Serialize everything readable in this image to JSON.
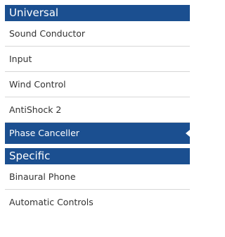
{
  "universal": {
    "title": "Universal",
    "items": [
      {
        "label": "Sound Conductor"
      },
      {
        "label": "Input"
      },
      {
        "label": "Wind Control"
      },
      {
        "label": "AntiShock 2"
      },
      {
        "label": "Phase Canceller"
      }
    ]
  },
  "specific": {
    "title": "Specific",
    "items": [
      {
        "label": "Binaural Phone"
      },
      {
        "label": "Automatic Controls"
      }
    ]
  },
  "colors": {
    "header_bg": "#1b4f90",
    "active_bg": "#1b4f90",
    "text": "#333333",
    "divider": "#d7d7d7"
  },
  "active_item": "Phase Canceller",
  "icons": {
    "active_indicator": "caret-left-icon"
  }
}
